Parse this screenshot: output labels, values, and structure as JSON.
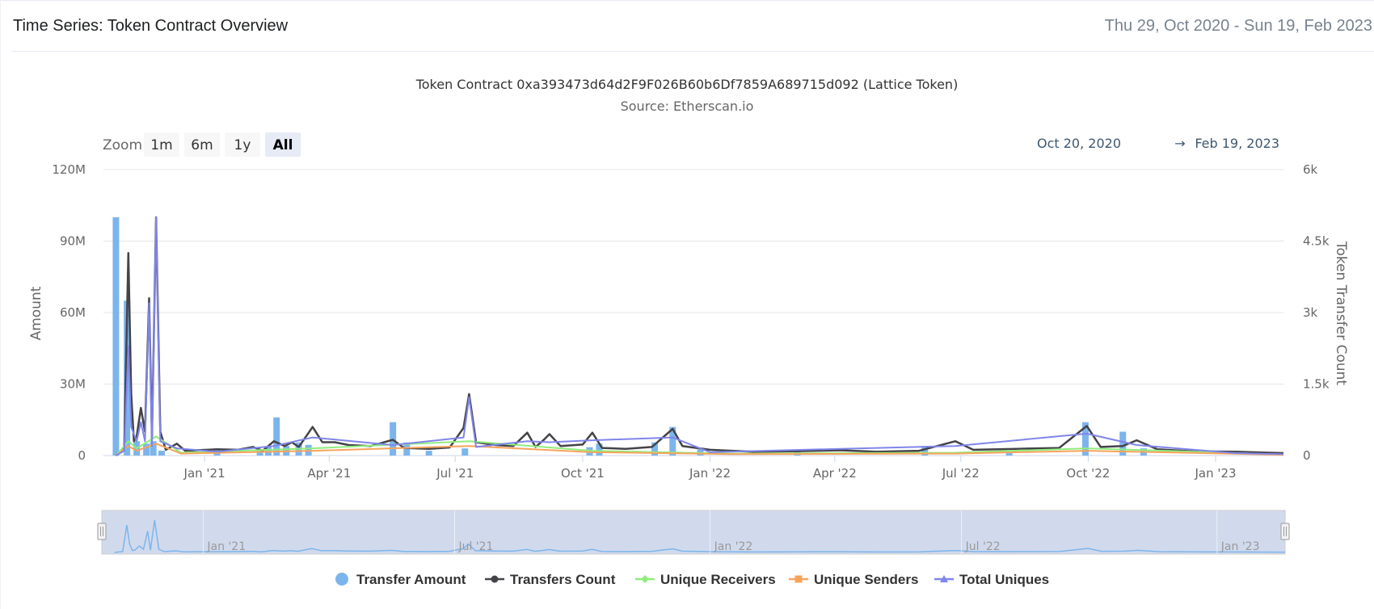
{
  "header": {
    "title": "Time Series: Token Contract Overview",
    "date_range": "Thu 29, Oct 2020 - Sun 19, Feb 2023"
  },
  "zoom": {
    "label": "Zoom",
    "buttons": [
      "1m",
      "6m",
      "1y",
      "All"
    ],
    "active": "All"
  },
  "range": {
    "from": "Oct 20, 2020",
    "arrow": "→",
    "to": "Feb 19, 2023"
  },
  "colors": {
    "transfer_amount": "#7cb5ec",
    "transfers_count": "#434348",
    "unique_receivers": "#90ed7d",
    "unique_senders": "#f7a35c",
    "total_uniques": "#8085e9",
    "navigator_fill": "#ccd6eb"
  },
  "chart_data": {
    "type": "line",
    "title": "Token Contract 0xa393473d64d2F9F026B60b6Df7859A689715d092 (Lattice Token)",
    "subtitle": "Source: Etherscan.io",
    "y_left": {
      "label": "Amount",
      "ylim": [
        0,
        120000000
      ],
      "ticks": [
        "0",
        "30M",
        "60M",
        "90M",
        "120M"
      ]
    },
    "y_right": {
      "label": "Token Transfer Count",
      "ylim": [
        0,
        6000
      ],
      "ticks": [
        "0",
        "1.5k",
        "3k",
        "4.5k",
        "6k"
      ]
    },
    "x_axis": {
      "type": "datetime",
      "xlim": [
        "2020-10-20",
        "2023-02-19"
      ],
      "ticks": [
        {
          "date": "2021-01-01",
          "label": "Jan '21"
        },
        {
          "date": "2021-04-01",
          "label": "Apr '21"
        },
        {
          "date": "2021-07-01",
          "label": "Jul '21"
        },
        {
          "date": "2021-10-01",
          "label": "Oct '21"
        },
        {
          "date": "2022-01-01",
          "label": "Jan '22"
        },
        {
          "date": "2022-04-01",
          "label": "Apr '22"
        },
        {
          "date": "2022-07-01",
          "label": "Jul '22"
        },
        {
          "date": "2022-10-01",
          "label": "Oct '22"
        },
        {
          "date": "2023-01-01",
          "label": "Jan '23"
        }
      ]
    },
    "navigator_labels": [
      "Jan '21",
      "Jul '21",
      "Jan '22",
      "Jul '22",
      "Jan '23"
    ],
    "legend": {
      "placement": "bottom-center"
    },
    "series": [
      {
        "name": "Transfer Amount",
        "kind": "column",
        "axis": "left",
        "points": [
          [
            "2020-10-29",
            100000000
          ],
          [
            "2020-11-06",
            65000000
          ],
          [
            "2020-11-13",
            6000000
          ],
          [
            "2020-11-20",
            5000000
          ],
          [
            "2020-11-25",
            6000000
          ],
          [
            "2020-12-01",
            2000000
          ],
          [
            "2021-01-10",
            3000000
          ],
          [
            "2021-02-10",
            2500000
          ],
          [
            "2021-02-16",
            4000000
          ],
          [
            "2021-02-22",
            16000000
          ],
          [
            "2021-03-01",
            4000000
          ],
          [
            "2021-03-10",
            5500000
          ],
          [
            "2021-03-17",
            4500000
          ],
          [
            "2021-05-17",
            14000000
          ],
          [
            "2021-05-27",
            5500000
          ],
          [
            "2021-06-12",
            2000000
          ],
          [
            "2021-07-08",
            3000000
          ],
          [
            "2021-10-06",
            3500000
          ],
          [
            "2021-10-13",
            5000000
          ],
          [
            "2021-11-22",
            5500000
          ],
          [
            "2021-12-05",
            12000000
          ],
          [
            "2021-12-25",
            2500000
          ],
          [
            "2022-03-05",
            2000000
          ],
          [
            "2022-06-05",
            4000000
          ],
          [
            "2022-08-05",
            1500000
          ],
          [
            "2022-09-29",
            14000000
          ],
          [
            "2022-10-26",
            10000000
          ],
          [
            "2022-11-10",
            3000000
          ]
        ]
      },
      {
        "name": "Transfers Count",
        "kind": "line",
        "axis": "right",
        "points": [
          [
            "2020-10-29",
            0
          ],
          [
            "2020-11-04",
            150
          ],
          [
            "2020-11-07",
            4250
          ],
          [
            "2020-11-09",
            1300
          ],
          [
            "2020-11-11",
            300
          ],
          [
            "2020-11-13",
            400
          ],
          [
            "2020-11-16",
            1000
          ],
          [
            "2020-11-19",
            500
          ],
          [
            "2020-11-22",
            3300
          ],
          [
            "2020-11-24",
            350
          ],
          [
            "2020-11-27",
            5000
          ],
          [
            "2020-11-30",
            500
          ],
          [
            "2020-12-04",
            120
          ],
          [
            "2020-12-12",
            250
          ],
          [
            "2020-12-18",
            100
          ],
          [
            "2021-01-10",
            130
          ],
          [
            "2021-01-25",
            120
          ],
          [
            "2021-02-05",
            180
          ],
          [
            "2021-02-12",
            100
          ],
          [
            "2021-02-20",
            300
          ],
          [
            "2021-02-28",
            200
          ],
          [
            "2021-03-05",
            280
          ],
          [
            "2021-03-10",
            180
          ],
          [
            "2021-03-20",
            600
          ],
          [
            "2021-03-27",
            280
          ],
          [
            "2021-04-05",
            280
          ],
          [
            "2021-04-15",
            220
          ],
          [
            "2021-05-01",
            200
          ],
          [
            "2021-05-17",
            330
          ],
          [
            "2021-05-25",
            160
          ],
          [
            "2021-06-12",
            140
          ],
          [
            "2021-06-27",
            170
          ],
          [
            "2021-07-07",
            580
          ],
          [
            "2021-07-11",
            1290
          ],
          [
            "2021-07-16",
            280
          ],
          [
            "2021-07-30",
            220
          ],
          [
            "2021-08-12",
            200
          ],
          [
            "2021-08-22",
            480
          ],
          [
            "2021-08-28",
            180
          ],
          [
            "2021-09-03",
            330
          ],
          [
            "2021-09-07",
            450
          ],
          [
            "2021-09-15",
            200
          ],
          [
            "2021-10-01",
            230
          ],
          [
            "2021-10-08",
            480
          ],
          [
            "2021-10-15",
            160
          ],
          [
            "2021-11-01",
            140
          ],
          [
            "2021-11-20",
            180
          ],
          [
            "2021-12-05",
            560
          ],
          [
            "2021-12-12",
            200
          ],
          [
            "2022-01-01",
            120
          ],
          [
            "2022-02-01",
            80
          ],
          [
            "2022-03-01",
            90
          ],
          [
            "2022-04-05",
            110
          ],
          [
            "2022-05-01",
            80
          ],
          [
            "2022-06-01",
            100
          ],
          [
            "2022-06-27",
            300
          ],
          [
            "2022-07-10",
            120
          ],
          [
            "2022-08-10",
            140
          ],
          [
            "2022-09-10",
            160
          ],
          [
            "2022-09-30",
            620
          ],
          [
            "2022-10-10",
            180
          ],
          [
            "2022-10-26",
            200
          ],
          [
            "2022-11-05",
            320
          ],
          [
            "2022-11-20",
            130
          ],
          [
            "2022-12-15",
            90
          ],
          [
            "2023-01-15",
            80
          ],
          [
            "2023-02-19",
            50
          ]
        ]
      },
      {
        "name": "Unique Receivers",
        "kind": "line",
        "axis": "right",
        "points": [
          [
            "2020-10-29",
            0
          ],
          [
            "2020-11-07",
            300
          ],
          [
            "2020-11-13",
            150
          ],
          [
            "2020-11-27",
            400
          ],
          [
            "2020-12-15",
            60
          ],
          [
            "2021-03-20",
            150
          ],
          [
            "2021-07-11",
            300
          ],
          [
            "2021-10-08",
            100
          ],
          [
            "2022-01-15",
            40
          ],
          [
            "2022-06-27",
            60
          ],
          [
            "2022-09-30",
            150
          ],
          [
            "2023-02-19",
            20
          ]
        ]
      },
      {
        "name": "Unique Senders",
        "kind": "line",
        "axis": "right",
        "points": [
          [
            "2020-10-29",
            0
          ],
          [
            "2020-11-07",
            200
          ],
          [
            "2020-11-13",
            100
          ],
          [
            "2020-11-27",
            250
          ],
          [
            "2020-12-15",
            40
          ],
          [
            "2021-03-20",
            100
          ],
          [
            "2021-07-11",
            200
          ],
          [
            "2021-10-08",
            70
          ],
          [
            "2022-01-15",
            30
          ],
          [
            "2022-06-27",
            40
          ],
          [
            "2022-09-30",
            100
          ],
          [
            "2023-02-19",
            15
          ]
        ]
      },
      {
        "name": "Total Uniques",
        "kind": "line",
        "axis": "right",
        "points": [
          [
            "2020-10-29",
            0
          ],
          [
            "2020-11-04",
            100
          ],
          [
            "2020-11-07",
            2300
          ],
          [
            "2020-11-09",
            600
          ],
          [
            "2020-11-13",
            300
          ],
          [
            "2020-11-16",
            700
          ],
          [
            "2020-11-19",
            300
          ],
          [
            "2020-11-22",
            3200
          ],
          [
            "2020-11-24",
            200
          ],
          [
            "2020-11-27",
            5000
          ],
          [
            "2020-11-30",
            300
          ],
          [
            "2020-12-12",
            150
          ],
          [
            "2021-01-10",
            80
          ],
          [
            "2021-02-20",
            200
          ],
          [
            "2021-03-20",
            380
          ],
          [
            "2021-05-17",
            220
          ],
          [
            "2021-07-07",
            380
          ],
          [
            "2021-07-11",
            1220
          ],
          [
            "2021-07-16",
            180
          ],
          [
            "2021-08-22",
            300
          ],
          [
            "2021-09-07",
            280
          ],
          [
            "2021-10-08",
            320
          ],
          [
            "2021-12-05",
            380
          ],
          [
            "2022-01-01",
            70
          ],
          [
            "2022-04-05",
            140
          ],
          [
            "2022-06-27",
            200
          ],
          [
            "2022-09-30",
            460
          ],
          [
            "2022-11-05",
            220
          ],
          [
            "2023-01-15",
            50
          ],
          [
            "2023-02-19",
            30
          ]
        ]
      }
    ]
  }
}
